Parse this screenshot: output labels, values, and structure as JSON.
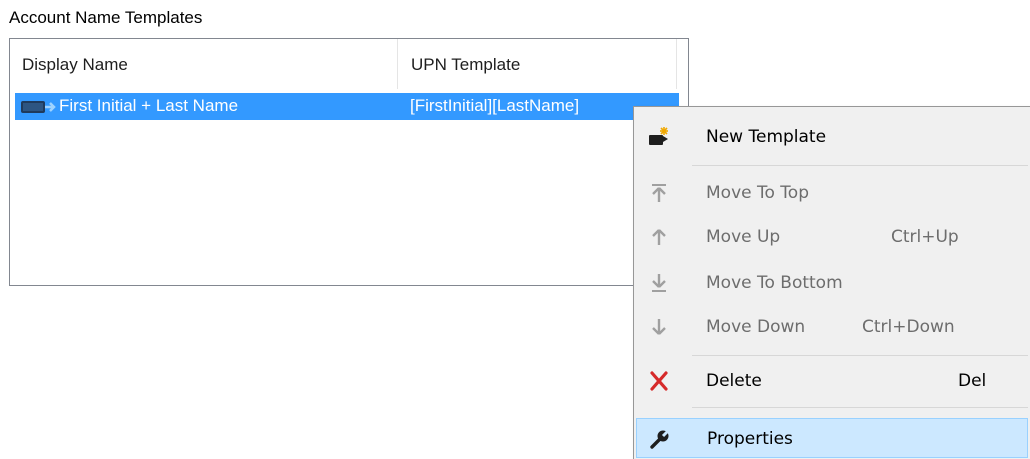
{
  "group": {
    "label": "Account Name Templates"
  },
  "list": {
    "columns": [
      "Display Name",
      "UPN Template"
    ],
    "rows": [
      {
        "display_name": "First Initial + Last Name",
        "upn_template": "[FirstInitial][LastName]",
        "selected": true
      }
    ]
  },
  "context_menu": {
    "items": [
      {
        "icon": "new-template-icon",
        "label": "New Template",
        "shortcut": "",
        "enabled": true
      },
      {
        "icon": "move-to-top-icon",
        "label": "Move To Top",
        "shortcut": "",
        "enabled": false
      },
      {
        "icon": "move-up-icon",
        "label": "Move Up",
        "shortcut": "Ctrl+Up",
        "enabled": false
      },
      {
        "icon": "move-to-bottom-icon",
        "label": "Move To Bottom",
        "shortcut": "",
        "enabled": false
      },
      {
        "icon": "move-down-icon",
        "label": "Move Down",
        "shortcut": "Ctrl+Down",
        "enabled": false
      },
      {
        "icon": "delete-icon",
        "label": "Delete",
        "shortcut": "Del",
        "enabled": true
      },
      {
        "icon": "properties-icon",
        "label": "Properties",
        "shortcut": "",
        "enabled": true,
        "highlighted": true
      }
    ]
  },
  "colors": {
    "selection": "#3399ff",
    "menu_highlight": "#cce8ff",
    "delete_red": "#d62a2a"
  }
}
